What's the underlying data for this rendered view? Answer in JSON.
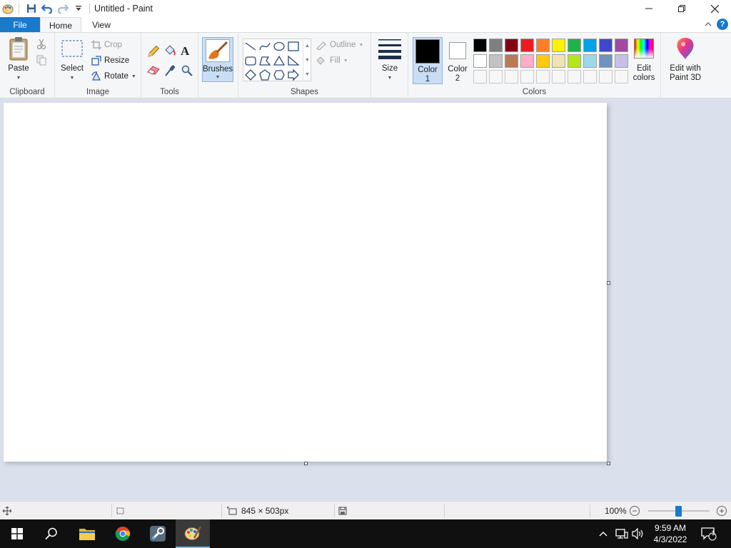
{
  "window": {
    "title": "Untitled - Paint"
  },
  "tabs": {
    "file": "File",
    "home": "Home",
    "view": "View"
  },
  "ribbon": {
    "clipboard": {
      "label": "Clipboard",
      "paste": "Paste"
    },
    "image": {
      "label": "Image",
      "select": "Select",
      "crop": "Crop",
      "resize": "Resize",
      "rotate": "Rotate"
    },
    "tools": {
      "label": "Tools"
    },
    "brushes": {
      "label": "Brushes"
    },
    "shapes": {
      "label": "Shapes",
      "outline": "Outline",
      "fill": "Fill"
    },
    "size": {
      "label": "Size"
    },
    "colors": {
      "label": "Colors",
      "color1_line1": "Color",
      "color1_line2": "1",
      "color2_line1": "Color",
      "color2_line2": "2",
      "edit_line1": "Edit",
      "edit_line2": "colors",
      "paint3d_line1": "Edit with",
      "paint3d_line2": "Paint 3D",
      "color1_value": "#000000",
      "color2_value": "#ffffff",
      "palette_row1": [
        "#000000",
        "#7f7f7f",
        "#880015",
        "#ed1c24",
        "#ff7f27",
        "#fff200",
        "#22b14c",
        "#00a2e8",
        "#3f48cc",
        "#a349a4"
      ],
      "palette_row2": [
        "#ffffff",
        "#c3c3c3",
        "#b97a57",
        "#ffaec9",
        "#ffc90e",
        "#efe4b0",
        "#b5e61d",
        "#99d9ea",
        "#7092be",
        "#c8bfe7"
      ],
      "palette_row3": [
        "#f7f7f7",
        "#f7f7f7",
        "#f7f7f7",
        "#f7f7f7",
        "#f7f7f7",
        "#f7f7f7",
        "#f7f7f7",
        "#f7f7f7",
        "#f7f7f7",
        "#f7f7f7"
      ]
    }
  },
  "status": {
    "canvas_size": "845 × 503px",
    "zoom": "100%",
    "zoom_fraction": 0.49
  },
  "taskbar": {
    "time": "9:59 AM",
    "date": "4/3/2022",
    "notification_count": "1"
  }
}
